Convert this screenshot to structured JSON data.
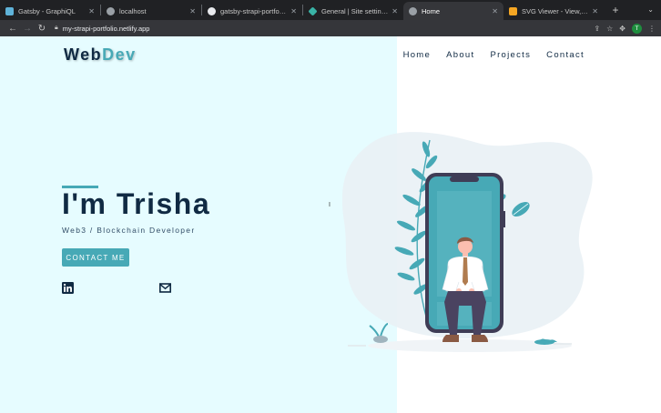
{
  "browser": {
    "tabs": [
      {
        "title": "Gatsby - GraphiQL",
        "favicon_color": "#5fb3d9"
      },
      {
        "title": "localhost",
        "favicon_color": "#9aa0a6"
      },
      {
        "title": "gatsby-strapi-portfolio-site",
        "favicon_color": "#e8eaed"
      },
      {
        "title": "General | Site settings",
        "favicon_color": "#39b3a6"
      },
      {
        "title": "Home",
        "favicon_color": "#9aa0a6"
      },
      {
        "title": "SVG Viewer - View, save, and",
        "favicon_color": "#f5a623"
      }
    ],
    "active_tab": 4,
    "url": "my-strapi-portfolio.netlify.app",
    "profile_initial": "T"
  },
  "site": {
    "logo_part1": "Web",
    "logo_part2": "Dev",
    "nav": [
      "Home",
      "About",
      "Projects",
      "Contact"
    ],
    "hero_title": "I'm Trisha",
    "hero_subtitle": "Web3 / Blockchain Developer",
    "cta_label": "CONTACT ME",
    "colors": {
      "accent": "#47a9b6",
      "dark": "#102a43",
      "left_bg": "#e6fcff"
    },
    "social_icons": [
      "linkedin-icon",
      "mail-icon"
    ]
  }
}
